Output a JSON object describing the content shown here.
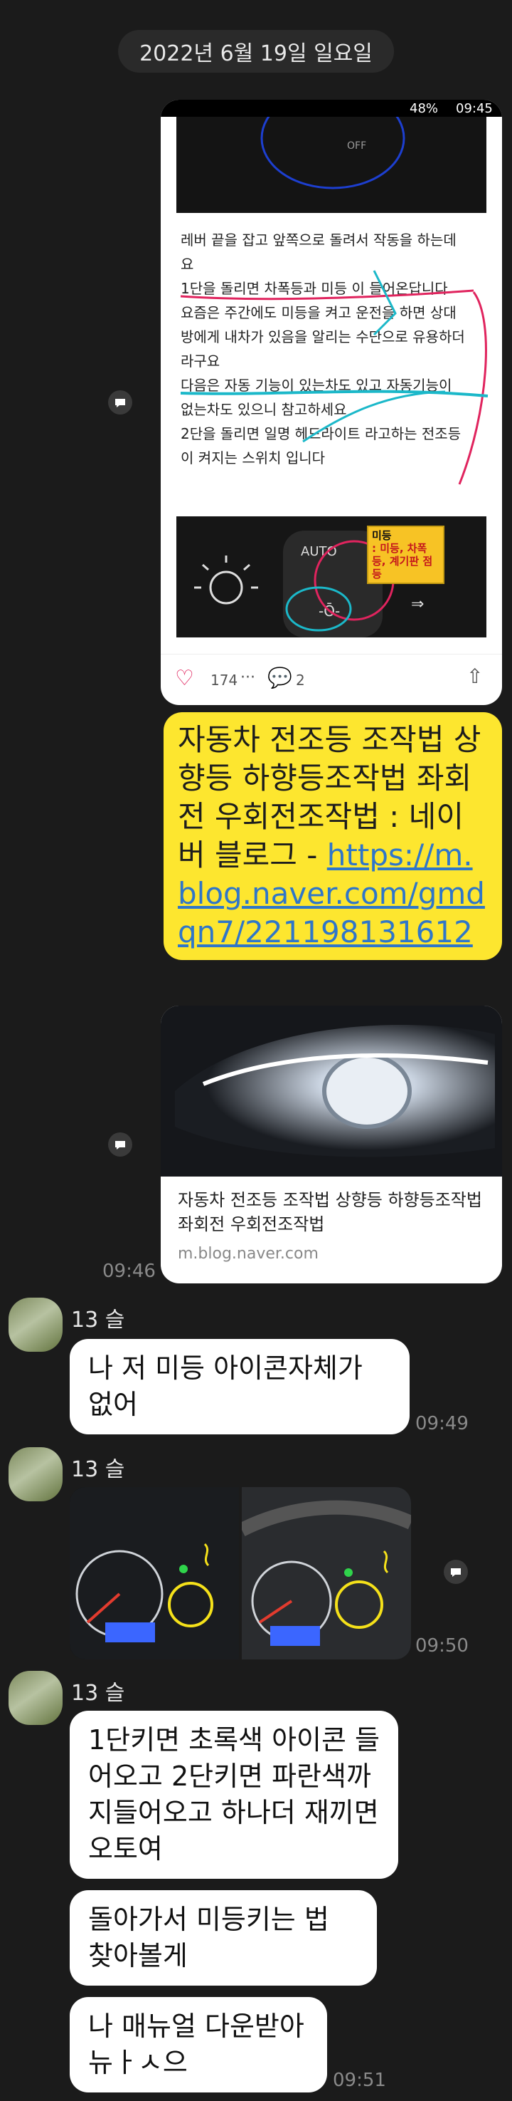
{
  "date_divider": "2022년 6월 19일 일요일",
  "shared_screenshot": {
    "status_time": "09:45",
    "battery": "48%",
    "text_lines": [
      "레버 끝을 잡고 앞쪽으로 돌려서 작동을 하는데",
      "요",
      "1단을 돌리면 차폭등과 미등 이 들어온답니다",
      "요즘은 주간에도 미등을 켜고 운전을 하면 상대",
      "방에게 내차가 있음을 알리는 수단으로 유용하더",
      "라구요",
      "다음은 자동 기능이 있는차도 있고 자동기능이",
      "없는차도 있으니 참고하세요",
      "2단을 돌리면 일명 헤드라이트 라고하는 전조등",
      "이 켜지는 스위치 입니다"
    ],
    "annotation_title": "미등",
    "annotation_body": ": 미등, 차폭등, 계기판 점등",
    "like_count": "174",
    "comment_count": "2"
  },
  "link_message": {
    "text": "자동차 전조등 조작법 상향등 하향등조작법 좌회전 우회전조작법 : 네이버 블로그 - ",
    "url": "https://m.blog.naver.com/gmdqn7/221198131612"
  },
  "link_preview": {
    "title": "자동차 전조등 조작법 상향등 하향등조작법 좌회전 우회전조작법",
    "domain": "m.blog.naver.com"
  },
  "sent_time": "09:46",
  "messages": [
    {
      "sender": "13 슬",
      "text": "나 저 미등 아이콘자체가 없어",
      "time": "09:49"
    },
    {
      "sender": "13 슬",
      "time": "09:50"
    },
    {
      "sender": "13 슬",
      "texts": [
        "1단키면 초록색 아이콘 들어오고 2단키면 파란색까지들어오고 하나더 재끼면 오토여",
        "돌아가서 미등키는 법 찾아볼게",
        "나 매뉴얼 다운받아뉴ㅏㅅ으"
      ],
      "time": "09:51"
    }
  ]
}
